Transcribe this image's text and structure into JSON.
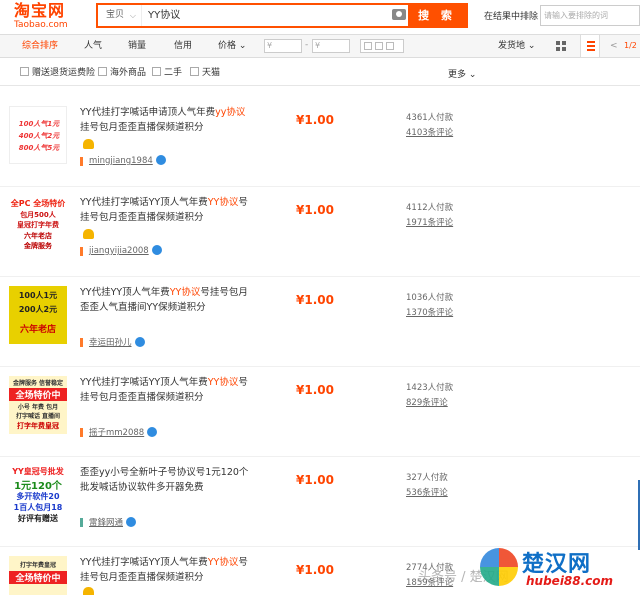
{
  "header": {
    "logo_cn": "淘宝网",
    "logo_en": "Taobao.com",
    "scope": "宝贝",
    "query": "YY协议",
    "search_label": "搜 索",
    "within_label": "在结果中排除",
    "within_placeholder": "请输入要排除的词"
  },
  "sortbar": {
    "items": [
      "综合排序",
      "人气",
      "销量",
      "信用",
      "价格"
    ],
    "price_from": "¥",
    "price_to": "¥",
    "dash": "-",
    "ship_from": "发货地",
    "pager_prev": "<",
    "pager_num": "1/2"
  },
  "filters": {
    "items": [
      "赠送退货运费险",
      "海外商品",
      "二手",
      "天猫"
    ],
    "more": "更多"
  },
  "items": [
    {
      "title_a": "YY代挂打字喊话申请顶人气年费",
      "title_kw": "yy协议",
      "title_b": "挂号包月歪歪直播保频道积分",
      "seller": "mingjiang1984",
      "price": "¥1.00",
      "buyers": "4361人付款",
      "reviews": "4103条评论",
      "thumb_lines": [
        "100人气1元",
        "400人气2元",
        "800人气5元"
      ]
    },
    {
      "title_a": "YY代挂打字喊话YY顶人气年费",
      "title_kw": "YY协议",
      "title_b": "号挂号包月歪歪直播保频道积分",
      "seller": "jiangyijia2008",
      "price": "¥1.00",
      "buyers": "4112人付款",
      "reviews": "1971条评论",
      "thumb_lines": [
        "全PC 全场特价",
        "包月500人",
        "皇冠打字年费",
        "六年老店",
        "金牌服务"
      ]
    },
    {
      "title_a": "YY代挂YY顶人气年费",
      "title_kw": "YY协议",
      "title_b": "号挂号包月歪歪人气直播间YY保频道积分",
      "seller": "幸运田孙儿",
      "price": "¥1.00",
      "buyers": "1036人付款",
      "reviews": "1370条评论",
      "thumb_lines": [
        "100人1元",
        "200人2元",
        "六年老店"
      ]
    },
    {
      "title_a": "YY代挂打字喊话YY顶人气年费",
      "title_kw": "YY协议",
      "title_b": "号挂号包月歪歪直播保频道积分",
      "seller": "摇子mm2088",
      "price": "¥1.00",
      "buyers": "1423人付款",
      "reviews": "829条评论",
      "thumb_lines": [
        "金牌服务 信誉稳定",
        "全场特价中",
        "小号 年费 包月",
        "打字喊话 直播间",
        "打字年费皇冠"
      ]
    },
    {
      "title_a": "歪歪yy小号全新叶子号协议号1元120个批发喊话协议软件多开器免费",
      "title_kw": "",
      "title_b": "",
      "seller": "雷鋒网通",
      "price": "¥1.00",
      "buyers": "327人付款",
      "reviews": "536条评论",
      "thumb_lines": [
        "YY皇冠号批发",
        "1元120个",
        "多开软件20",
        "1百人包月18",
        "好评有赠送"
      ]
    },
    {
      "title_a": "YY代挂打字喊话YY顶人气年费",
      "title_kw": "YY协议",
      "title_b": "号挂号包月歪歪直播保频道积分",
      "seller": "",
      "price": "¥1.00",
      "buyers": "2774人付款",
      "reviews": "1859条评论",
      "thumb_lines": [
        "打字年费皇冠",
        "全场特价中"
      ]
    }
  ],
  "watermark": {
    "text": "头条号 / 楚汉网",
    "brand": "楚汉网",
    "domain": "hubei88.com"
  },
  "colors": {
    "accent": "#ff4400",
    "search_border": "#ff5000",
    "link_blue": "#2f8ce0"
  }
}
